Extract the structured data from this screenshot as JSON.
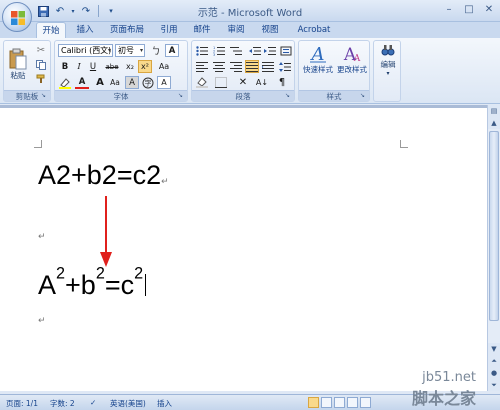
{
  "window": {
    "title": "示范 - Microsoft Word",
    "controls": [
      "minimize",
      "maximize",
      "close"
    ]
  },
  "quick_access": {
    "icons": [
      "save-icon",
      "undo-icon",
      "undo-dropdown-icon",
      "redo-icon",
      "customize-qat-icon"
    ]
  },
  "tabs": [
    "开始",
    "插入",
    "页面布局",
    "引用",
    "邮件",
    "审阅",
    "视图",
    "Acrobat"
  ],
  "active_tab": "开始",
  "ribbon": {
    "clipboard": {
      "paste_label": "粘贴",
      "group_label": "剪贴板"
    },
    "font": {
      "font_name": "Calibri (西文)",
      "font_size": "初号",
      "group_label": "字体",
      "buttons_row2": [
        "B",
        "I",
        "U",
        "abe",
        "x₂",
        "x²",
        "Aa"
      ],
      "buttons_row3": [
        "A",
        "A",
        "Aa",
        "A",
        "A"
      ]
    },
    "paragraph": {
      "group_label": "段落"
    },
    "styles": {
      "quick_styles_label": "快速样式",
      "change_styles_label": "更改样式",
      "group_label": "样式"
    },
    "editing": {
      "label": "编辑"
    }
  },
  "document": {
    "line1": "A2+b2=c2",
    "line2": {
      "a": "A",
      "b": "+b",
      "c": "=c",
      "exp": "2"
    },
    "para_mark": "↵",
    "arrow_color": "#e0201c"
  },
  "status": {
    "page": "页面: 1/1",
    "words": "字数: 2",
    "language": "英语(美国)",
    "mode": "插入"
  },
  "watermark": {
    "top": "jb51.net",
    "bottom": "脚本之家"
  }
}
